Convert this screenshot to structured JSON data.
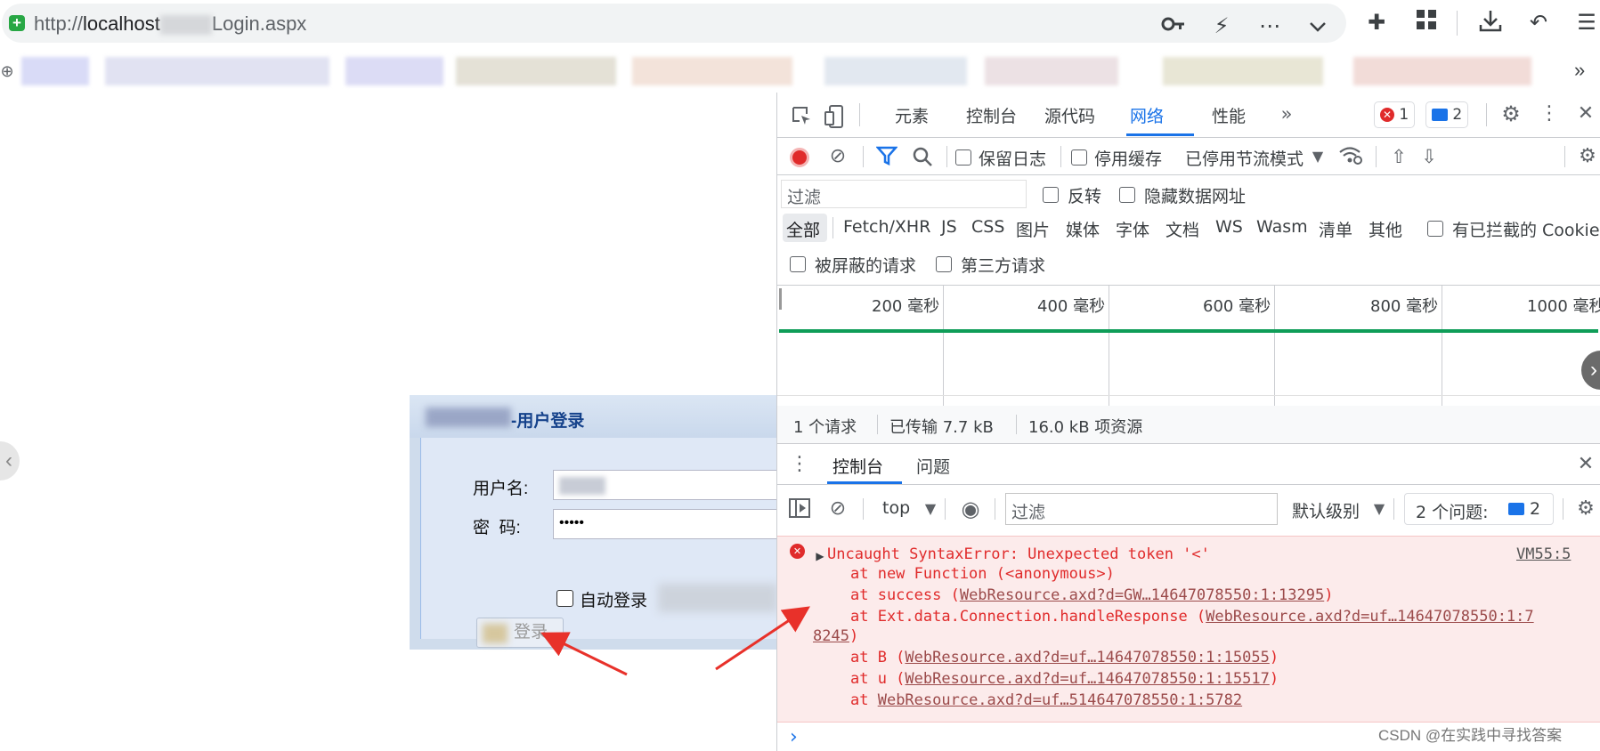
{
  "browser": {
    "url_prefix": "http://",
    "url_host": "localhost",
    "url_suffix": "Login.aspx",
    "more_bookmarks": "»"
  },
  "page": {
    "login": {
      "title": "-用户登录",
      "username_label": "用户名:",
      "password_label": "密  码:",
      "password_value": "•••••",
      "auto_login_label": "自动登录",
      "login_button": "登录"
    }
  },
  "devtools": {
    "tabs": [
      "元素",
      "控制台",
      "源代码",
      "网络",
      "性能"
    ],
    "active_tab": "网络",
    "error_count": "1",
    "issue_count": "2",
    "network_toolbar": {
      "preserve_log": "保留日志",
      "disable_cache": "停用缓存",
      "throttling": "已停用节流模式"
    },
    "filter": {
      "placeholder": "过滤",
      "invert": "反转",
      "hide_data_urls": "隐藏数据网址"
    },
    "type_filters": [
      "全部",
      "Fetch/XHR",
      "JS",
      "CSS",
      "图片",
      "媒体",
      "字体",
      "文档",
      "WS",
      "Wasm",
      "清单",
      "其他"
    ],
    "blocked_cookies": "有已拦截的 Cookie",
    "blocked_requests": "被屏蔽的请求",
    "third_party": "第三方请求",
    "timeline_ticks": [
      "200 毫秒",
      "400 毫秒",
      "600 毫秒",
      "800 毫秒",
      "1000 毫秒"
    ],
    "status": {
      "requests": "1 个请求",
      "transferred": "已传输 7.7 kB",
      "resources": "16.0 kB 项资源"
    },
    "drawer_tabs": [
      "控制台",
      "问题"
    ],
    "console_toolbar": {
      "context": "top",
      "filter_placeholder": "过滤",
      "level": "默认级别",
      "issues_label": "2 个问题:",
      "issues_count": "2"
    },
    "console_error": {
      "message": "Uncaught SyntaxError: Unexpected token '<'",
      "source": "VM55:5",
      "stack": [
        {
          "prefix": "at new Function (<anonymous>)",
          "link": "",
          "suffix": ""
        },
        {
          "prefix": "at success (",
          "link": "WebResource.axd?d=GW…14647078550:1:13295",
          "suffix": ")"
        },
        {
          "prefix": "at Ext.data.Connection.handleResponse (",
          "link": "WebResource.axd?d=uf…14647078550:1:7",
          "suffix": ""
        },
        {
          "prefix": "",
          "link": "8245",
          "suffix": ")"
        },
        {
          "prefix": "at B (",
          "link": "WebResource.axd?d=uf…14647078550:1:15055",
          "suffix": ")"
        },
        {
          "prefix": "at u (",
          "link": "WebResource.axd?d=uf…14647078550:1:15517",
          "suffix": ")"
        },
        {
          "prefix": "at ",
          "link": "WebResource.axd?d=uf…514647078550:1:5782",
          "suffix": ""
        }
      ]
    },
    "prompt": "›"
  },
  "watermark": "CSDN @在实践中寻找答案",
  "colors": {
    "accent": "#1a73e8",
    "error": "#e02b2b",
    "error_bg": "#fcebeb",
    "arrow": "#e8312a",
    "waterfall": "#0f9d58"
  }
}
